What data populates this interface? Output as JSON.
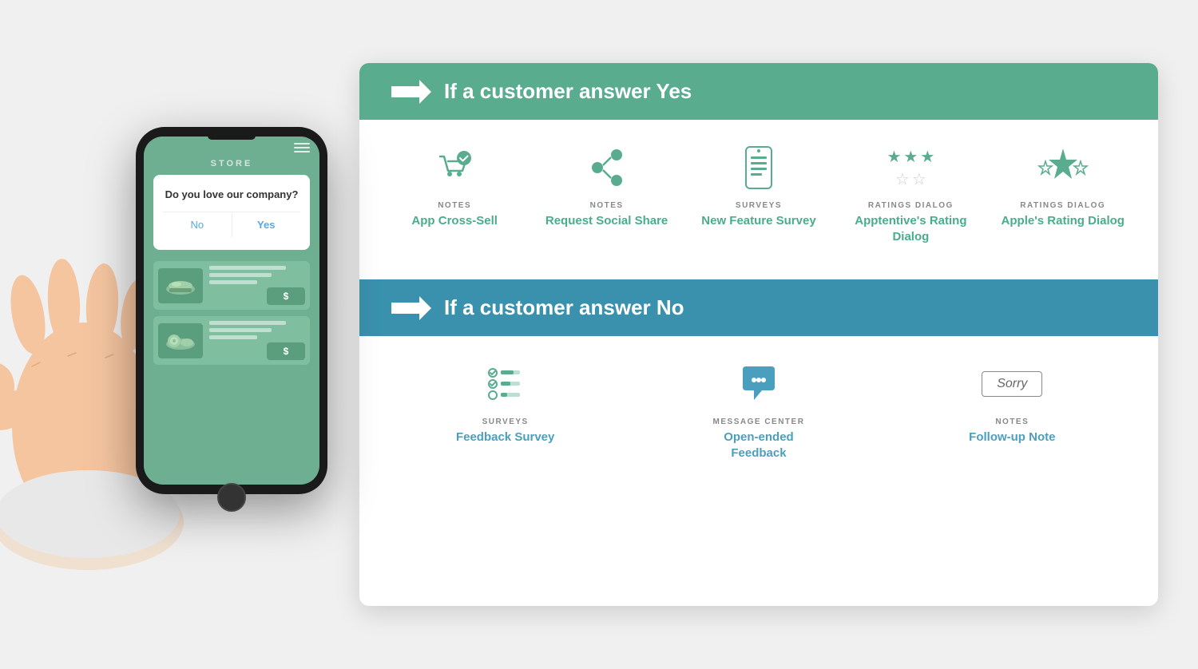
{
  "phone": {
    "store_label": "STORE",
    "dialog_question": "Do you love our company?",
    "btn_no": "No",
    "btn_yes": "Yes",
    "product_buy": "$"
  },
  "yes_section": {
    "arrow": "→",
    "title": "If a customer answer Yes",
    "items": [
      {
        "id": "app-cross-sell",
        "category": "NOTES",
        "name": "App Cross-Sell",
        "icon_type": "cart"
      },
      {
        "id": "request-social-share",
        "category": "NOTES",
        "name": "Request Social Share",
        "icon_type": "share"
      },
      {
        "id": "new-feature-survey",
        "category": "SURVEYS",
        "name": "New Feature Survey",
        "icon_type": "phone-list"
      },
      {
        "id": "apptentive-rating",
        "category": "RATINGS DIALOG",
        "name": "Apptentive's Rating Dialog",
        "icon_type": "stars-3"
      },
      {
        "id": "apple-rating",
        "category": "RATINGS DIALOG",
        "name": "Apple's Rating Dialog",
        "icon_type": "stars-big"
      }
    ]
  },
  "no_section": {
    "arrow": "→",
    "title": "If a customer answer No",
    "items": [
      {
        "id": "feedback-survey",
        "category": "SURVEYS",
        "name": "Feedback Survey",
        "icon_type": "checklist"
      },
      {
        "id": "open-ended-feedback",
        "category": "MESSAGE CENTER",
        "name": "Open-ended Feedback",
        "icon_type": "chat"
      },
      {
        "id": "follow-up-note",
        "category": "NOTES",
        "name": "Follow-up Note",
        "icon_type": "sorry"
      }
    ]
  }
}
